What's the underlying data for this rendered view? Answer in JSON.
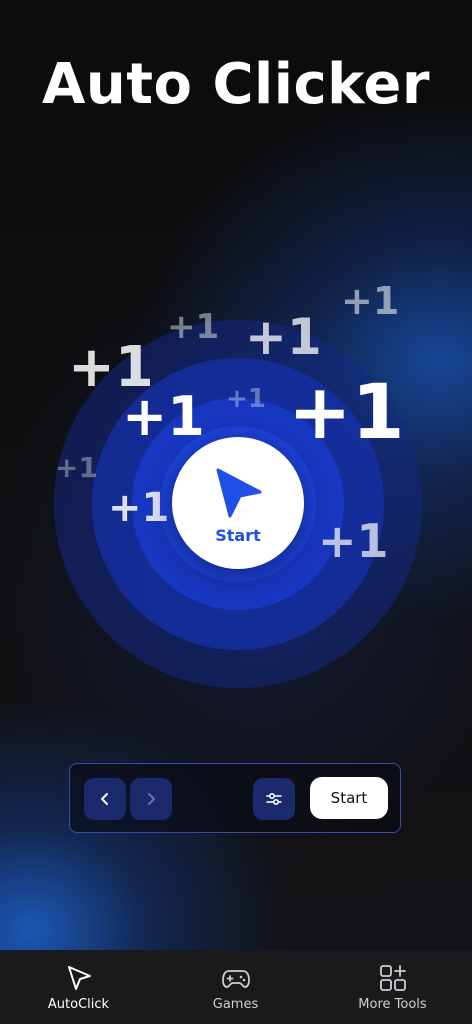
{
  "app": {
    "title": "Auto Clicker"
  },
  "stage": {
    "start_label": "Start",
    "floating_labels": [
      "+1",
      "+1",
      "+1",
      "+1",
      "+1",
      "+1",
      "+1",
      "+1",
      "+1",
      "+1"
    ]
  },
  "toolbar": {
    "prev_icon": "chevron-left-icon",
    "next_icon": "chevron-right-icon",
    "settings_icon": "sliders-icon",
    "start_label": "Start"
  },
  "bottom_nav": {
    "items": [
      {
        "label": "AutoClick",
        "icon": "cursor-icon",
        "active": true
      },
      {
        "label": "Games",
        "icon": "gamepad-icon",
        "active": false
      },
      {
        "label": "More Tools",
        "icon": "grid-plus-icon",
        "active": false
      }
    ]
  },
  "colors": {
    "accent": "#1f4ee8",
    "background": "#0d0d0f",
    "nav_background": "#1a1a1c",
    "toolbar_button": "#1a2a6c"
  }
}
